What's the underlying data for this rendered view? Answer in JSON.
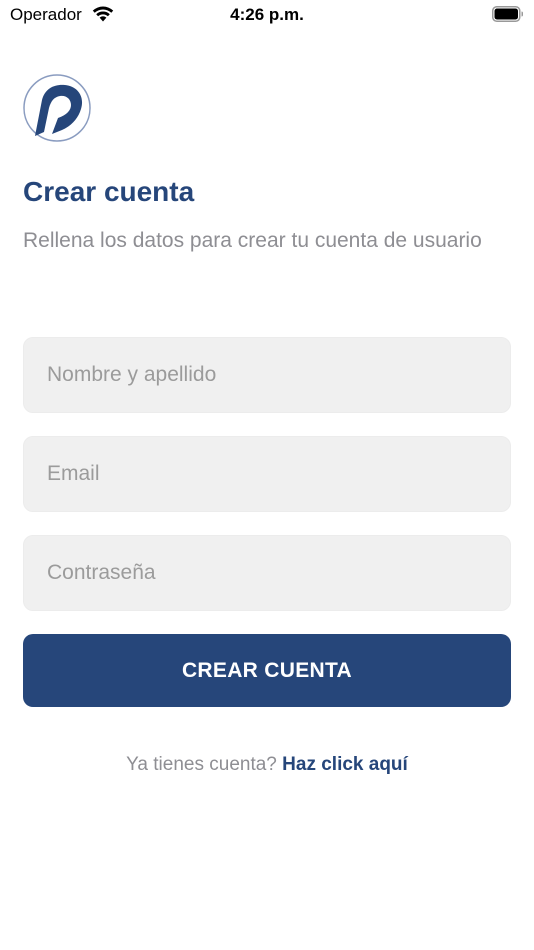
{
  "status_bar": {
    "carrier": "Operador",
    "time": "4:26 p.m."
  },
  "icons": {
    "logo": "brand-logo-icon",
    "wifi": "wifi-icon",
    "battery": "battery-icon"
  },
  "colors": {
    "brand": "#26467a",
    "input_bg": "#f0f0f0",
    "muted_text": "#8e8e93"
  },
  "header": {
    "title": "Crear cuenta",
    "subtitle": "Rellena los datos para crear tu cuenta de usuario"
  },
  "form": {
    "name_placeholder": "Nombre y apellido",
    "email_placeholder": "Email",
    "password_placeholder": "Contraseña",
    "submit_label": "CREAR CUENTA"
  },
  "footer": {
    "prompt": "Ya tienes cuenta?",
    "link_label": "Haz click aquí"
  }
}
